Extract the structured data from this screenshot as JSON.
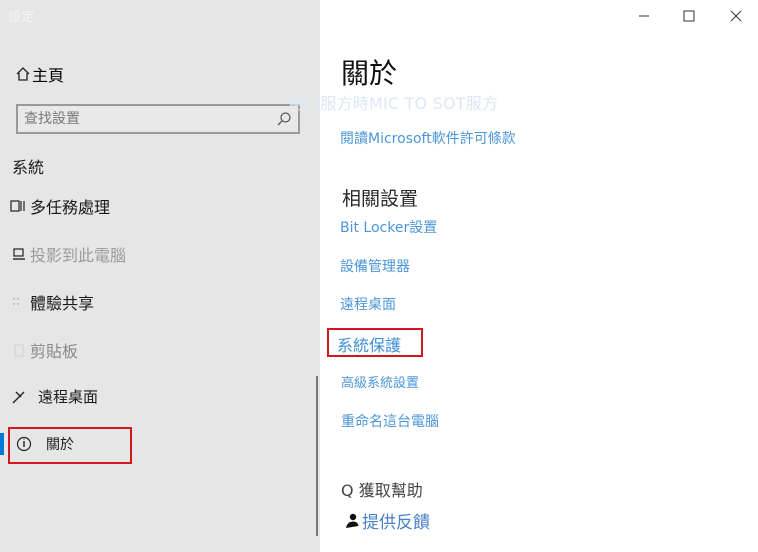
{
  "window": {
    "title": "設定"
  },
  "sidebar": {
    "home_label": "主頁",
    "search_placeholder": "查找設置",
    "section_title": "系統",
    "items": [
      {
        "label": "多任務處理",
        "icon": "multitask-icon"
      },
      {
        "label": "投影到此電腦",
        "icon": "project-icon"
      },
      {
        "label": "體驗共享",
        "icon": "shared-experiences-icon"
      },
      {
        "label": "剪貼板",
        "icon": "clipboard-icon"
      },
      {
        "label": "遠程桌面",
        "icon": "remote-desktop-icon"
      },
      {
        "label": "關於",
        "icon": "info-icon",
        "selected": true
      }
    ]
  },
  "main": {
    "title": "關於",
    "overlay_text": "用门服方時MIC TO SOT服方",
    "license_link": "閱讀Microsoft軟件許可條款",
    "related_title": "相關設置",
    "links": [
      "Bit Locker設置",
      "設備管理器",
      "遠程桌面",
      "系統保護",
      "高級系統設置",
      "重命名這台電腦"
    ],
    "help_label": "獲取幫助",
    "feedback_label": "提供反饋"
  },
  "colors": {
    "accent": "#0078d7",
    "link": "#4b96d8",
    "highlight": "#d4161d",
    "sidebar_bg": "#e6e6e6"
  }
}
